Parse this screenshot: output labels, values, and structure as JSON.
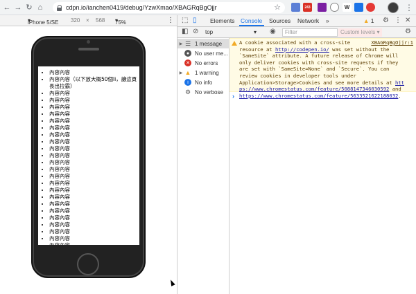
{
  "browser": {
    "url": "cdpn.io/ianchen0419/debug/YzwXmao/XBAGRqBgOjjr",
    "ext_badge": "243",
    "ext_w": "W"
  },
  "device_toolbar": {
    "device": "iPhone 5/SE",
    "width": "320",
    "times": "×",
    "height": "568",
    "zoom": "75%"
  },
  "page": {
    "items": [
      "內容內容",
      "內容內容（以下放大概50個li，讓這頁長出拉霸）",
      "內容內容",
      "內容內容",
      "內容內容",
      "內容內容",
      "內容內容",
      "內容內容",
      "內容內容",
      "內容內容",
      "內容內容",
      "內容內容",
      "內容內容",
      "內容內容",
      "內容內容",
      "內容內容",
      "內容內容",
      "內容內容",
      "內容內容",
      "內容內容",
      "內容內容",
      "內容內容",
      "內容內容",
      "內容內容",
      "內容內容"
    ]
  },
  "devtools": {
    "tabs": [
      "Elements",
      "Console",
      "Sources",
      "Network"
    ],
    "more_tabs": "»",
    "warning_count": "1",
    "context": "top",
    "filter_placeholder": "Filter",
    "levels": "Custom levels ▾",
    "sidebar": [
      {
        "label": "1 message",
        "icon": "list-icon"
      },
      {
        "label": "No user me...",
        "icon": "user-icon"
      },
      {
        "label": "No errors",
        "icon": "error-icon"
      },
      {
        "label": "1 warning",
        "icon": "warning-icon"
      },
      {
        "label": "No info",
        "icon": "info-icon"
      },
      {
        "label": "No verbose",
        "icon": "verbose-icon"
      }
    ],
    "warning": {
      "source": "XBAGRqBgOjjr:1",
      "line1": "A cookie associated with a cross-site",
      "line2a": "resource at ",
      "line2_link": "http://codepen.io/",
      "line2b": " was set without the",
      "line3": "`SameSite` attribute. A future release of Chrome will",
      "line4": "only deliver cookies with cross-site requests if they",
      "line5": "are set with `SameSite=None` and `Secure`. You can",
      "line6": "review cookies in developer tools under",
      "line7a": "Application>Storage>Cookies and see more details at ",
      "line7_link": "htt",
      "line8_link": "ps://www.chromestatus.com/feature/5088147346030592",
      "line8b": " and",
      "line9_link": "https://www.chromestatus.com/feature/5633521622188032",
      "line9b": "."
    },
    "prompt": "›"
  }
}
